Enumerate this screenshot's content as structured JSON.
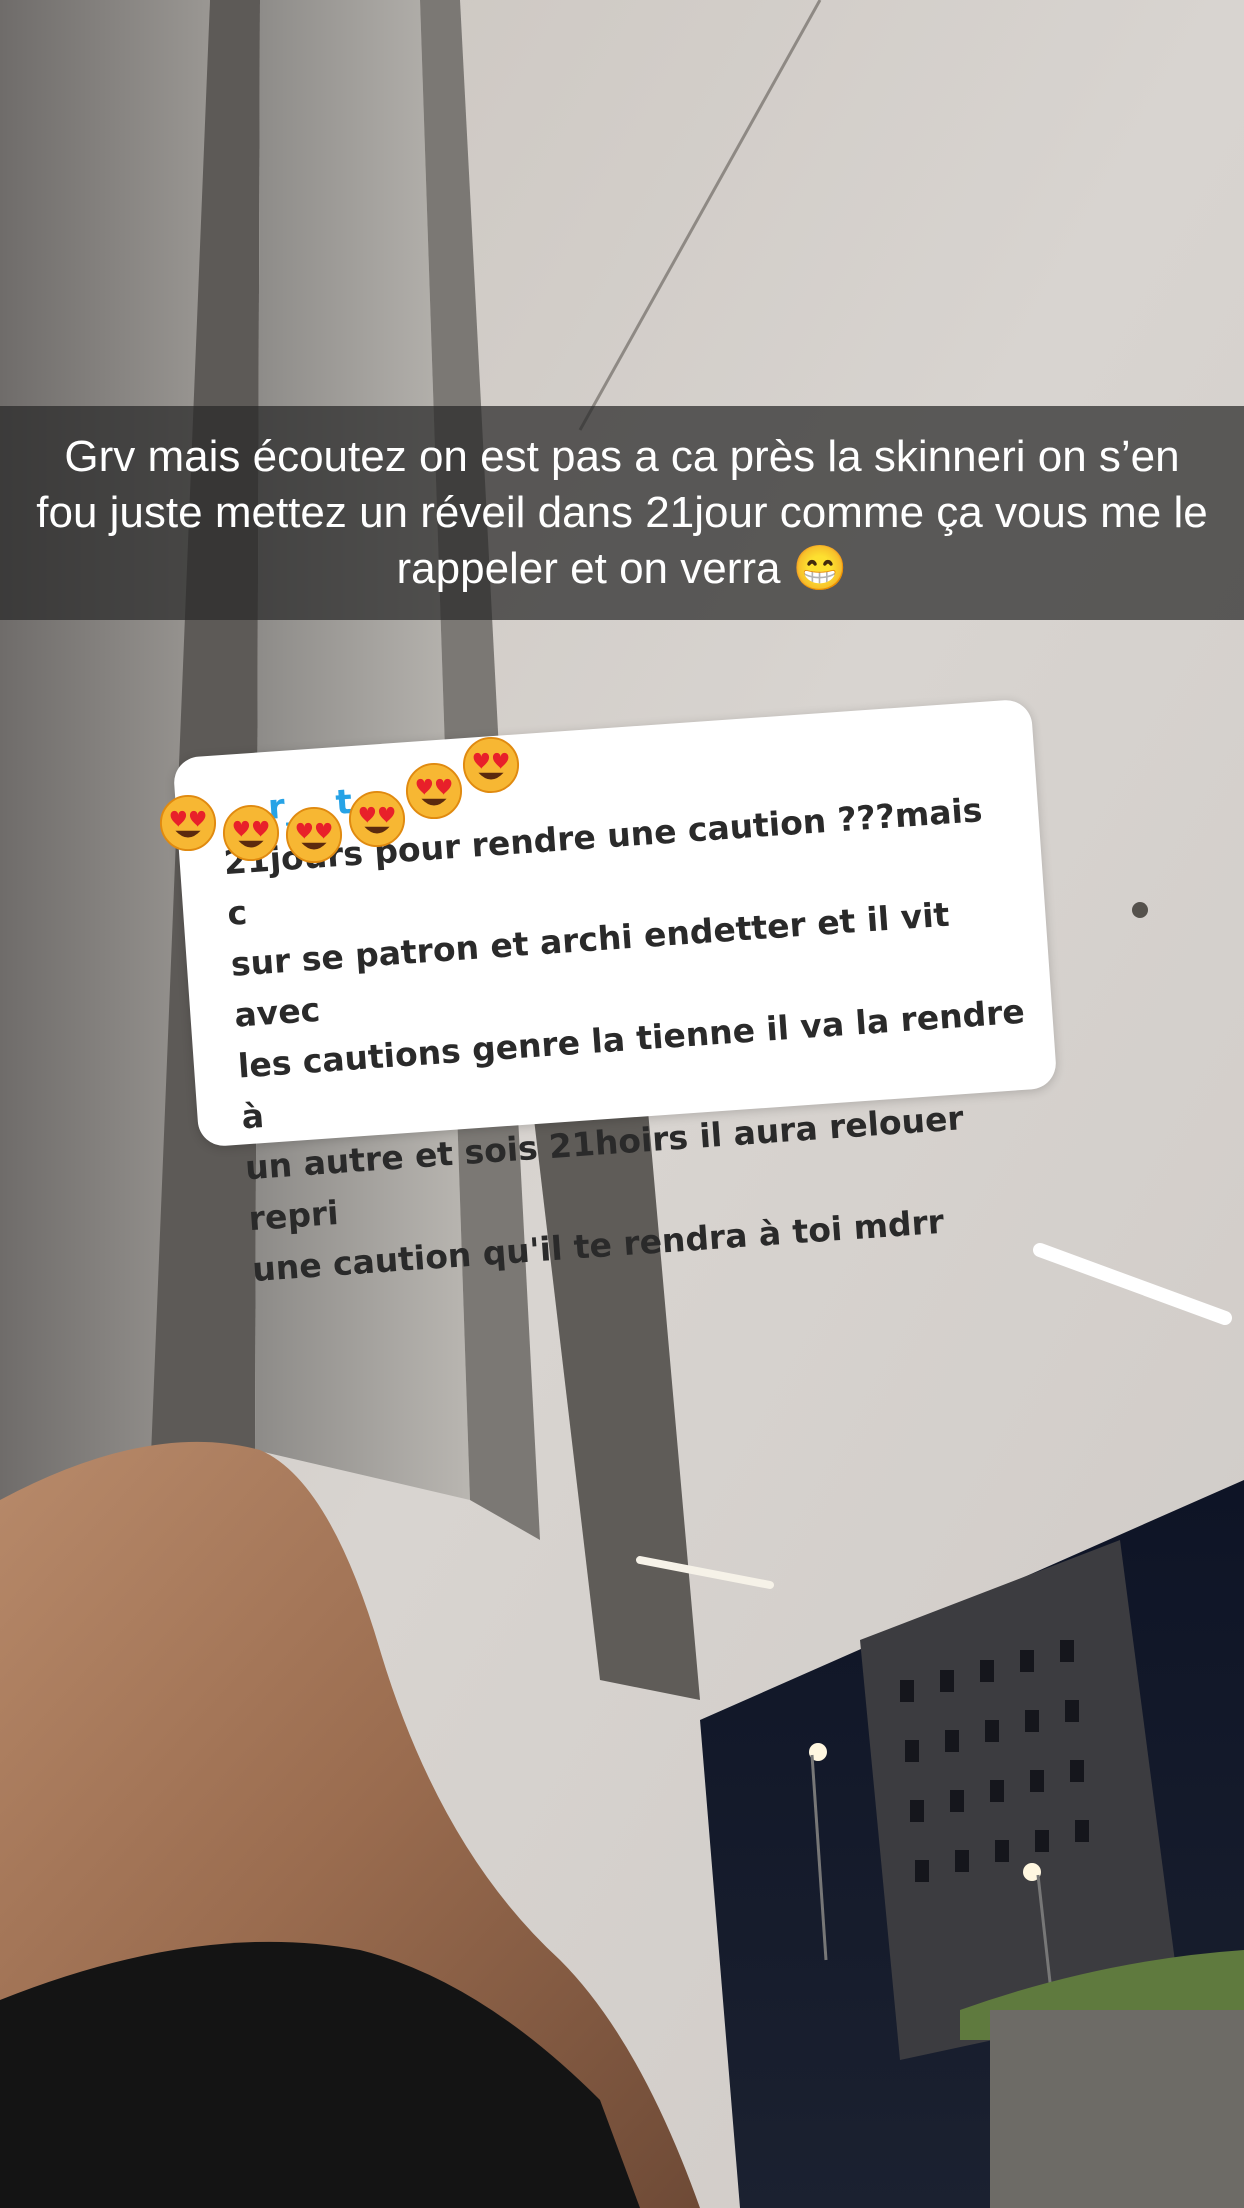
{
  "caption": {
    "text": "Grv mais écoutez on est pas a ca près la skinneri on s’en fou juste mettez un réveil dans 21jour comme ça vous me le rappeler et on verra 😁"
  },
  "reply_card": {
    "author": "r___t",
    "text": "21jours pour rendre une caution ???mais c\nsur se patron et archi endetter et il vit avec\nles cautions genre la tienne il va la rendre à\nun autre et sois 21hoirs il aura relouer repri\nune caution qu'il te rendra à toi mdrr",
    "emojis": [
      "heart-eyes-emoji",
      "heart-eyes-emoji",
      "heart-eyes-emoji",
      "heart-eyes-emoji",
      "heart-eyes-emoji",
      "heart-eyes-emoji"
    ]
  },
  "colors": {
    "caption_bar": "#282828",
    "card": "#ffffff",
    "author": "#27a3e6",
    "reply_text": "#2a2a2a"
  }
}
